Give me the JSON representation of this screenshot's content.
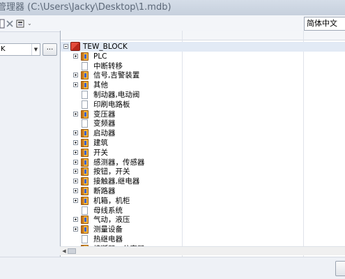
{
  "window": {
    "title": "管理器 (C:\\Users\\Jacky\\Desktop\\1.mdb)"
  },
  "toolbar": {
    "icons": [
      "document-icon",
      "delete-icon",
      "properties-icon"
    ],
    "language": "简体中文"
  },
  "left_panel": {
    "combo_value": "K",
    "browse_label": "..."
  },
  "tree": {
    "root": "TEW_BLOCK",
    "items": [
      {
        "label": "PLC",
        "type": "folder"
      },
      {
        "label": "中断转移",
        "type": "doc"
      },
      {
        "label": "信号,吉警装置",
        "type": "folder"
      },
      {
        "label": "其他",
        "type": "folder"
      },
      {
        "label": "制动器,电动阀",
        "type": "doc"
      },
      {
        "label": "印刷电路板",
        "type": "doc"
      },
      {
        "label": "变压器",
        "type": "folder"
      },
      {
        "label": "变频器",
        "type": "doc"
      },
      {
        "label": "启动器",
        "type": "folder"
      },
      {
        "label": "建筑",
        "type": "folder"
      },
      {
        "label": "开关",
        "type": "folder"
      },
      {
        "label": "感测器，传感器",
        "type": "folder"
      },
      {
        "label": "按钮，开关",
        "type": "folder"
      },
      {
        "label": "接触器,继电器",
        "type": "folder"
      },
      {
        "label": "断路器",
        "type": "folder"
      },
      {
        "label": "机箱，机柜",
        "type": "folder"
      },
      {
        "label": "母线系统",
        "type": "doc"
      },
      {
        "label": "气动，液压",
        "type": "folder"
      },
      {
        "label": "测量设备",
        "type": "folder"
      },
      {
        "label": "热继电器",
        "type": "doc"
      },
      {
        "label": "熔断器，分离器",
        "type": "folder"
      }
    ]
  }
}
